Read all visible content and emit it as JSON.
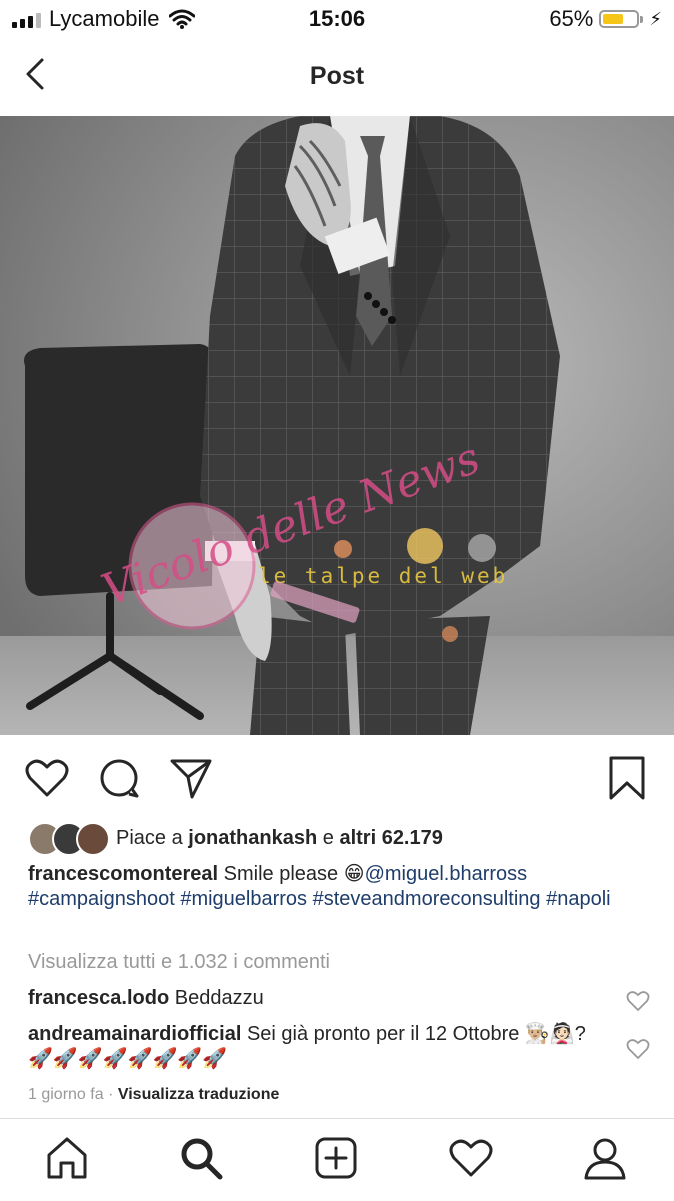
{
  "status": {
    "carrier": "Lycamobile",
    "time": "15:06",
    "battery": "65%",
    "battery_level": 0.65
  },
  "nav": {
    "title": "Post"
  },
  "photo": {
    "watermark_1": "Vicolo delle News",
    "watermark_2": "le talpe del web"
  },
  "post": {
    "likes_prefix": "Piace a",
    "liked_by": "jonathankash",
    "likes_join": "e",
    "likes_others": "altri 62.179",
    "author": "francescomontereal",
    "caption_text": "Smile please 😁",
    "mention": "@miguel.bharross",
    "hashtags": "#campaignshoot #miguelbarros #steveandmoreconsulting #napoli",
    "view_all_comments": "Visualizza tutti e 1.032 i commenti",
    "comments": [
      {
        "user": "francesca.lodo",
        "text": "Beddazzu"
      },
      {
        "user": "andreamainardiofficial",
        "text": "Sei già pronto per il 12 Ottobre 👨🏼‍🍳👰🏻? 🚀🚀🚀🚀🚀🚀🚀🚀"
      }
    ],
    "time_ago": "1 giorno fa",
    "meta_separator": "·",
    "translate": "Visualizza traduzione"
  },
  "tabs": [
    "home-icon",
    "search-icon",
    "new-post-icon",
    "activity-icon",
    "profile-icon"
  ]
}
